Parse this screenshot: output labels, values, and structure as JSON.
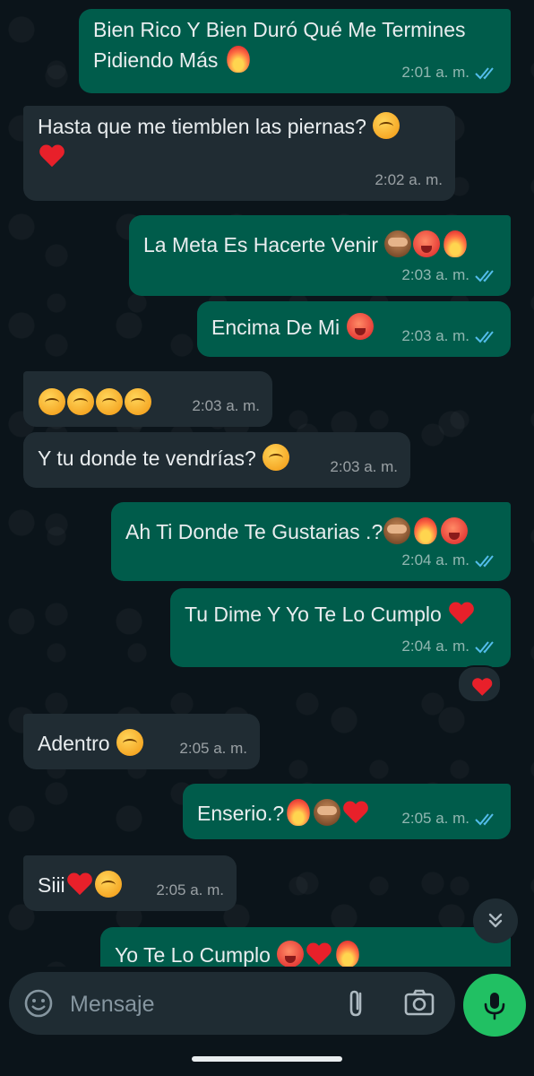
{
  "messages": [
    {
      "dir": "out",
      "text": "Bien Rico Y Bien Duró Qué Me Termines Pidiendo Más",
      "emojis": [
        "fire"
      ],
      "time": "2:01 a. m.",
      "read": true
    },
    {
      "dir": "in",
      "text": "Hasta que me tiemblen las piernas?",
      "emojis": [
        "face-peeking",
        "heart"
      ],
      "time": "2:02 a. m."
    },
    {
      "dir": "out",
      "text": "La Meta Es Hacerte Venir",
      "emojis": [
        "see-no-evil-monkey",
        "hot-face",
        "fire"
      ],
      "time": "2:03 a. m.",
      "read": true
    },
    {
      "dir": "out",
      "text": "Encima De Mi",
      "emojis": [
        "hot-face"
      ],
      "time": "2:03 a. m.",
      "read": true
    },
    {
      "dir": "in",
      "text": "",
      "emojis": [
        "face-peeking",
        "face-peeking",
        "face-peeking",
        "face-peeking"
      ],
      "time": "2:03 a. m."
    },
    {
      "dir": "in",
      "text": "Y tu donde te vendrías?",
      "emojis": [
        "face-peeking"
      ],
      "time": "2:03 a. m."
    },
    {
      "dir": "out",
      "text": "Ah Ti Donde Te Gustarias .?",
      "emojis": [
        "see-no-evil-monkey",
        "fire",
        "hot-face"
      ],
      "time": "2:04 a. m.",
      "read": true
    },
    {
      "dir": "out",
      "text": "Tu Dime Y Yo Te Lo Cumplo",
      "emojis": [
        "heart"
      ],
      "time": "2:04 a. m.",
      "read": true,
      "reaction": "heart"
    },
    {
      "dir": "in",
      "text": "Adentro",
      "emojis": [
        "face-peeking"
      ],
      "time": "2:05 a. m."
    },
    {
      "dir": "out",
      "text": "Enserio.?",
      "emojis": [
        "fire",
        "see-no-evil-monkey",
        "heart"
      ],
      "time": "2:05 a. m.",
      "read": true
    },
    {
      "dir": "in",
      "text": "Siii",
      "emojis": [
        "heart",
        "face-peeking"
      ],
      "time": "2:05 a. m."
    },
    {
      "dir": "out",
      "text": "Yo Te Lo Cumplo",
      "emojis": [
        "hot-face",
        "heart",
        "fire"
      ],
      "time": "",
      "read": true
    }
  ],
  "composer": {
    "placeholder": "Mensaje"
  },
  "colors": {
    "outgoing": "#005c4b",
    "incoming": "#202c33",
    "accent": "#21c063",
    "read_ticks": "#53bdeb"
  },
  "icons": {
    "emoji": "emoji-icon",
    "attach": "paperclip-icon",
    "camera": "camera-icon",
    "mic": "mic-icon",
    "scroll": "double-chevron-down-icon"
  }
}
